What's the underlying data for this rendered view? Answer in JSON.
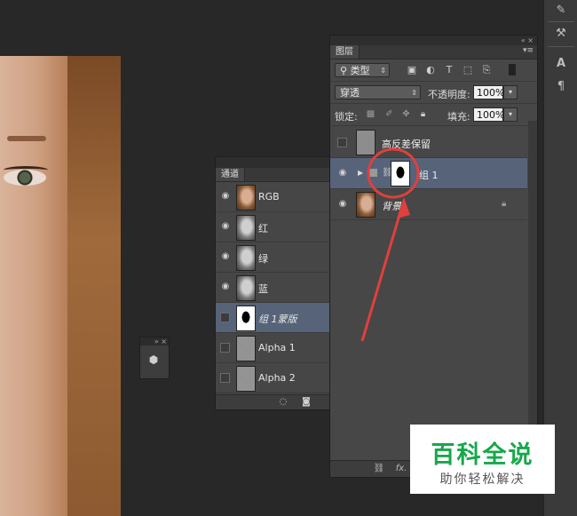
{
  "layers_panel": {
    "tab": "图层",
    "filter": {
      "kind": "类型"
    },
    "blend_mode": "穿透",
    "opacity_label": "不透明度:",
    "opacity_value": "100%",
    "lock_label": "锁定:",
    "fill_label": "填充:",
    "fill_value": "100%",
    "layers": [
      {
        "name": "高反差保留",
        "visible": false,
        "selected": false,
        "italic": false,
        "thumb": "gray-flat"
      },
      {
        "name": "组 1",
        "visible": true,
        "selected": true,
        "italic": false,
        "thumb": "mask",
        "group": true
      },
      {
        "name": "背景",
        "visible": true,
        "selected": false,
        "italic": true,
        "thumb": "face",
        "locked": true
      }
    ],
    "bottom_icons": [
      "link-icon",
      "fx-icon"
    ],
    "bottom_fx": "fx."
  },
  "channels_panel": {
    "tab": "通道",
    "channels": [
      {
        "name": "RGB",
        "visible": true,
        "selected": false,
        "italic": false,
        "thumb": "face"
      },
      {
        "name": "红",
        "visible": true,
        "selected": false,
        "italic": false,
        "thumb": "gray"
      },
      {
        "name": "绿",
        "visible": true,
        "selected": false,
        "italic": false,
        "thumb": "gray"
      },
      {
        "name": "蓝",
        "visible": true,
        "selected": false,
        "italic": false,
        "thumb": "gray"
      },
      {
        "name": "组 1蒙版",
        "visible": false,
        "selected": true,
        "italic": true,
        "thumb": "mask"
      },
      {
        "name": "Alpha 1",
        "visible": false,
        "selected": false,
        "italic": false,
        "thumb": "noise"
      },
      {
        "name": "Alpha 2",
        "visible": false,
        "selected": false,
        "italic": false,
        "thumb": "noise"
      }
    ]
  },
  "watermark": {
    "title": "百科全说",
    "subtitle": "助你轻松解决"
  },
  "colors": {
    "selection": "#566379",
    "panel": "#474747",
    "annotation": "#e0403c",
    "watermark_green": "#16a84a"
  }
}
